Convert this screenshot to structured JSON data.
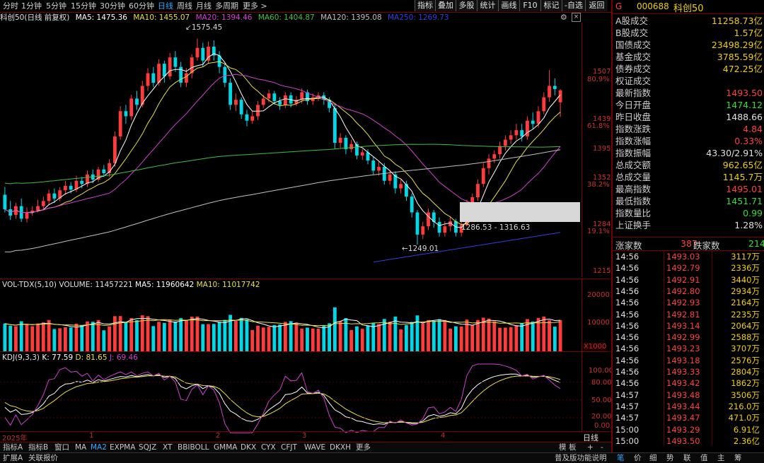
{
  "toolbar": {
    "periods": [
      "分时",
      "1分钟",
      "5分钟",
      "15分钟",
      "30分钟",
      "60分钟",
      "日线",
      "周线",
      "月线",
      "多周期",
      "更多 >"
    ],
    "active_period": "日线",
    "buttons": [
      "指标",
      "叠加",
      "多股",
      "统计",
      "画线",
      "F10",
      "标记",
      "-自选",
      "返回"
    ]
  },
  "ma_line": {
    "title": "科创50(日线 前复权)",
    "ma5": "MA5: 1475.36",
    "ma10": "MA10: 1455.07",
    "ma20": "MA20: 1394.46",
    "ma60": "MA60: 1404.87",
    "ma120": "MA120: 1395.08",
    "ma250": "MA250: 1269.73"
  },
  "colors": {
    "up": "#ff3b3b",
    "down": "#00d8e8",
    "ma5": "#ffffff",
    "ma10": "#e8e040",
    "ma20": "#d040d0",
    "ma60": "#40c040",
    "ma120": "#c0c0c0",
    "ma250": "#3040e0",
    "frame": "#7a0000"
  },
  "price_axis": {
    "labels": [
      "1507",
      "1439",
      "1395",
      "1352",
      "1284",
      "1215"
    ],
    "pct": [
      "80.9%",
      "61.8%",
      "38.2%",
      "19.1%"
    ]
  },
  "annotations": {
    "high": "1575.45",
    "low": "1249.01",
    "gap": "1286.53 - 1316.63"
  },
  "volume": {
    "title": "VOL-TDX(5,10)",
    "volume": "VOLUME: 11457221",
    "ma5": "MA5: 11960642",
    "ma10": "MA10: 11017742",
    "axis": [
      "20000",
      "10000"
    ],
    "unit": "X1000"
  },
  "kdj": {
    "title": "KDJ(9,3,3)",
    "k": "K: 77.59",
    "d": "D: 81.65",
    "j": "J: 69.46",
    "axis": [
      "100.00",
      "80.00",
      "50.00",
      "20.00",
      "0.00"
    ]
  },
  "x_axis": {
    "labels": [
      "2025年",
      "1",
      "2",
      "3",
      "4"
    ],
    "right_label": "日线"
  },
  "tabs": {
    "items": [
      "指标A",
      "指标B",
      "窗口",
      "MA",
      "MA2",
      "EXPMA",
      "SQJZ",
      "XT",
      "BBIBOLL",
      "GMMA",
      "DKX",
      "CYX",
      "CFJT",
      "WAVE",
      "DKXH",
      "更多"
    ],
    "active": "MA2",
    "right": [
      "模",
      "板",
      "+",
      "-"
    ]
  },
  "statusbar": {
    "left": [
      "扩展A",
      "关联报价"
    ],
    "right": [
      "普及版功能说明",
      "笔",
      "价",
      "细",
      "势",
      "联",
      "值",
      "主",
      "筹"
    ]
  },
  "panel": {
    "code": "000688",
    "name": "科创50",
    "market_flag": "G",
    "rows": [
      {
        "label": "A股成交",
        "value": "11258.73亿",
        "color": "#f0d000"
      },
      {
        "label": "B股成交",
        "value": "1.57亿",
        "color": "#f0d000"
      },
      {
        "label": "国债成交",
        "value": "23498.29亿",
        "color": "#f0d000"
      },
      {
        "label": "基金成交",
        "value": "3785.59亿",
        "color": "#f0d000"
      },
      {
        "label": "债券成交",
        "value": "472.25亿",
        "color": "#f0d000"
      },
      {
        "label": "权证成交",
        "value": "",
        "color": "#f0d000"
      },
      {
        "label": "最新指数",
        "value": "1493.50",
        "color": "#ff4040"
      },
      {
        "label": "今日开盘",
        "value": "1474.12",
        "color": "#30e030"
      },
      {
        "label": "昨日收盘",
        "value": "1488.66",
        "color": "#e0e0e0"
      },
      {
        "label": "指数涨跌",
        "value": "4.84",
        "color": "#ff4040"
      },
      {
        "label": "指数涨幅",
        "value": "0.33%",
        "color": "#ff4040"
      },
      {
        "label": "指数振幅",
        "value": "43.30/2.91%",
        "color": "#e0e0e0"
      },
      {
        "label": "总成交额",
        "value": "962.65亿",
        "color": "#f0d000"
      },
      {
        "label": "总成交量",
        "value": "1145.7万",
        "color": "#f0d000"
      },
      {
        "label": "最高指数",
        "value": "1495.01",
        "color": "#ff4040"
      },
      {
        "label": "最低指数",
        "value": "1451.71",
        "color": "#30e030"
      },
      {
        "label": "指数量比",
        "value": "0.99",
        "color": "#30e030"
      },
      {
        "label": "上证换手",
        "value": "1.28%",
        "color": "#e0e0e0"
      }
    ],
    "breadth": {
      "up_label": "涨家数",
      "up": "387",
      "down_label": "跌家数",
      "down": "214"
    },
    "ticks": [
      {
        "t": "14:56",
        "p": "1493.03",
        "v": "3117万"
      },
      {
        "t": "14:56",
        "p": "1492.79",
        "v": "2336万"
      },
      {
        "t": "14:56",
        "p": "1492.91",
        "v": "3440万"
      },
      {
        "t": "14:56",
        "p": "1492.80",
        "v": "2934万"
      },
      {
        "t": "14:56",
        "p": "1492.93",
        "v": "2164万"
      },
      {
        "t": "14:56",
        "p": "1492.81",
        "v": "2235万"
      },
      {
        "t": "14:56",
        "p": "1493.14",
        "v": "2064万"
      },
      {
        "t": "14:56",
        "p": "1492.99",
        "v": "2588万"
      },
      {
        "t": "14:56",
        "p": "1493.23",
        "v": "3707万"
      },
      {
        "t": "14:56",
        "p": "1493.18",
        "v": "2576万"
      },
      {
        "t": "14:56",
        "p": "1493.33",
        "v": "2804万"
      },
      {
        "t": "14:56",
        "p": "1493.42",
        "v": "1862万"
      },
      {
        "t": "14:57",
        "p": "1493.48",
        "v": "3506万"
      },
      {
        "t": "14:57",
        "p": "1493.44",
        "v": "216.0万"
      },
      {
        "t": "14:57",
        "p": "1493.47",
        "v": "471.0万"
      },
      {
        "t": "15:00",
        "p": "1493.29",
        "v": "6.91亿"
      },
      {
        "t": "15:00",
        "p": "1493.50",
        "v": "2.36亿"
      }
    ]
  },
  "chart_data": {
    "type": "candlestick",
    "candles": [
      [
        1328,
        1305,
        1340,
        1300
      ],
      [
        1305,
        1295,
        1318,
        1288
      ],
      [
        1296,
        1310,
        1315,
        1290
      ],
      [
        1310,
        1290,
        1322,
        1285
      ],
      [
        1290,
        1300,
        1308,
        1284
      ],
      [
        1300,
        1303,
        1310,
        1295
      ],
      [
        1303,
        1310,
        1320,
        1300
      ],
      [
        1310,
        1318,
        1325,
        1305
      ],
      [
        1318,
        1330,
        1336,
        1312
      ],
      [
        1330,
        1322,
        1338,
        1315
      ],
      [
        1322,
        1335,
        1340,
        1318
      ],
      [
        1335,
        1342,
        1350,
        1328
      ],
      [
        1342,
        1336,
        1348,
        1330
      ],
      [
        1336,
        1350,
        1358,
        1332
      ],
      [
        1350,
        1345,
        1356,
        1338
      ],
      [
        1345,
        1360,
        1366,
        1340
      ],
      [
        1360,
        1352,
        1368,
        1346
      ],
      [
        1352,
        1368,
        1372,
        1348
      ],
      [
        1368,
        1362,
        1375,
        1356
      ],
      [
        1362,
        1378,
        1384,
        1356
      ],
      [
        1378,
        1420,
        1428,
        1372
      ],
      [
        1420,
        1460,
        1468,
        1415
      ],
      [
        1460,
        1452,
        1470,
        1440
      ],
      [
        1452,
        1480,
        1486,
        1446
      ],
      [
        1480,
        1470,
        1492,
        1462
      ],
      [
        1470,
        1500,
        1508,
        1466
      ],
      [
        1500,
        1520,
        1528,
        1492
      ],
      [
        1520,
        1505,
        1530,
        1498
      ],
      [
        1505,
        1535,
        1542,
        1500
      ],
      [
        1535,
        1515,
        1540,
        1505
      ],
      [
        1515,
        1545,
        1552,
        1510
      ],
      [
        1545,
        1530,
        1555,
        1522
      ],
      [
        1530,
        1505,
        1538,
        1498
      ],
      [
        1505,
        1520,
        1528,
        1498
      ],
      [
        1520,
        1545,
        1550,
        1512
      ],
      [
        1545,
        1560,
        1575,
        1540
      ],
      [
        1560,
        1540,
        1568,
        1530
      ],
      [
        1540,
        1562,
        1570,
        1535
      ],
      [
        1562,
        1548,
        1572,
        1540
      ],
      [
        1548,
        1530,
        1555,
        1520
      ],
      [
        1530,
        1505,
        1536,
        1498
      ],
      [
        1505,
        1470,
        1512,
        1462
      ],
      [
        1470,
        1478,
        1488,
        1460
      ],
      [
        1478,
        1455,
        1482,
        1448
      ],
      [
        1455,
        1445,
        1462,
        1436
      ],
      [
        1445,
        1452,
        1460,
        1440
      ],
      [
        1452,
        1470,
        1476,
        1446
      ],
      [
        1470,
        1480,
        1486,
        1465
      ],
      [
        1480,
        1488,
        1494,
        1474
      ],
      [
        1488,
        1476,
        1492,
        1470
      ],
      [
        1476,
        1470,
        1482,
        1462
      ],
      [
        1470,
        1485,
        1490,
        1465
      ],
      [
        1485,
        1472,
        1490,
        1466
      ],
      [
        1472,
        1478,
        1484,
        1468
      ],
      [
        1478,
        1490,
        1496,
        1472
      ],
      [
        1490,
        1476,
        1494,
        1470
      ],
      [
        1476,
        1482,
        1488,
        1470
      ],
      [
        1482,
        1485,
        1490,
        1476
      ],
      [
        1485,
        1478,
        1490,
        1470
      ],
      [
        1478,
        1465,
        1482,
        1458
      ],
      [
        1465,
        1410,
        1470,
        1400
      ],
      [
        1410,
        1418,
        1425,
        1402
      ],
      [
        1418,
        1400,
        1422,
        1392
      ],
      [
        1400,
        1408,
        1415,
        1395
      ],
      [
        1408,
        1390,
        1412,
        1384
      ],
      [
        1390,
        1395,
        1400,
        1383
      ],
      [
        1395,
        1382,
        1400,
        1376
      ],
      [
        1382,
        1366,
        1388,
        1360
      ],
      [
        1366,
        1372,
        1380,
        1358
      ],
      [
        1372,
        1350,
        1378,
        1344
      ],
      [
        1350,
        1360,
        1366,
        1344
      ],
      [
        1360,
        1338,
        1365,
        1330
      ],
      [
        1338,
        1345,
        1352,
        1330
      ],
      [
        1345,
        1325,
        1350,
        1318
      ],
      [
        1325,
        1300,
        1330,
        1292
      ],
      [
        1300,
        1265,
        1304,
        1249
      ],
      [
        1265,
        1278,
        1285,
        1258
      ],
      [
        1278,
        1300,
        1306,
        1272
      ],
      [
        1300,
        1285,
        1304,
        1276
      ],
      [
        1285,
        1268,
        1292,
        1262
      ],
      [
        1268,
        1278,
        1286,
        1262
      ],
      [
        1278,
        1286,
        1294,
        1270
      ],
      [
        1286,
        1268,
        1290,
        1262
      ],
      [
        1268,
        1280,
        1286,
        1262
      ],
      [
        1280,
        1316,
        1320,
        1278
      ],
      [
        1316,
        1324,
        1330,
        1308
      ],
      [
        1324,
        1345,
        1352,
        1318
      ],
      [
        1345,
        1370,
        1378,
        1340
      ],
      [
        1370,
        1385,
        1392,
        1360
      ],
      [
        1385,
        1392,
        1398,
        1378
      ],
      [
        1392,
        1405,
        1412,
        1385
      ],
      [
        1405,
        1415,
        1422,
        1398
      ],
      [
        1415,
        1422,
        1430,
        1408
      ],
      [
        1422,
        1430,
        1440,
        1415
      ],
      [
        1430,
        1420,
        1440,
        1412
      ],
      [
        1420,
        1445,
        1452,
        1415
      ],
      [
        1445,
        1440,
        1458,
        1432
      ],
      [
        1440,
        1460,
        1468,
        1434
      ],
      [
        1460,
        1482,
        1490,
        1455
      ],
      [
        1482,
        1500,
        1525,
        1475
      ],
      [
        1500,
        1495,
        1512,
        1485
      ],
      [
        1474,
        1493,
        1495,
        1451
      ]
    ],
    "series": [
      {
        "name": "MA5",
        "value": 1475.36
      },
      {
        "name": "MA10",
        "value": 1455.07
      },
      {
        "name": "MA20",
        "value": 1394.46
      },
      {
        "name": "MA60",
        "value": 1404.87
      },
      {
        "name": "MA120",
        "value": 1395.08
      },
      {
        "name": "MA250",
        "value": 1269.73
      }
    ],
    "ylim": [
      1200,
      1600
    ]
  }
}
